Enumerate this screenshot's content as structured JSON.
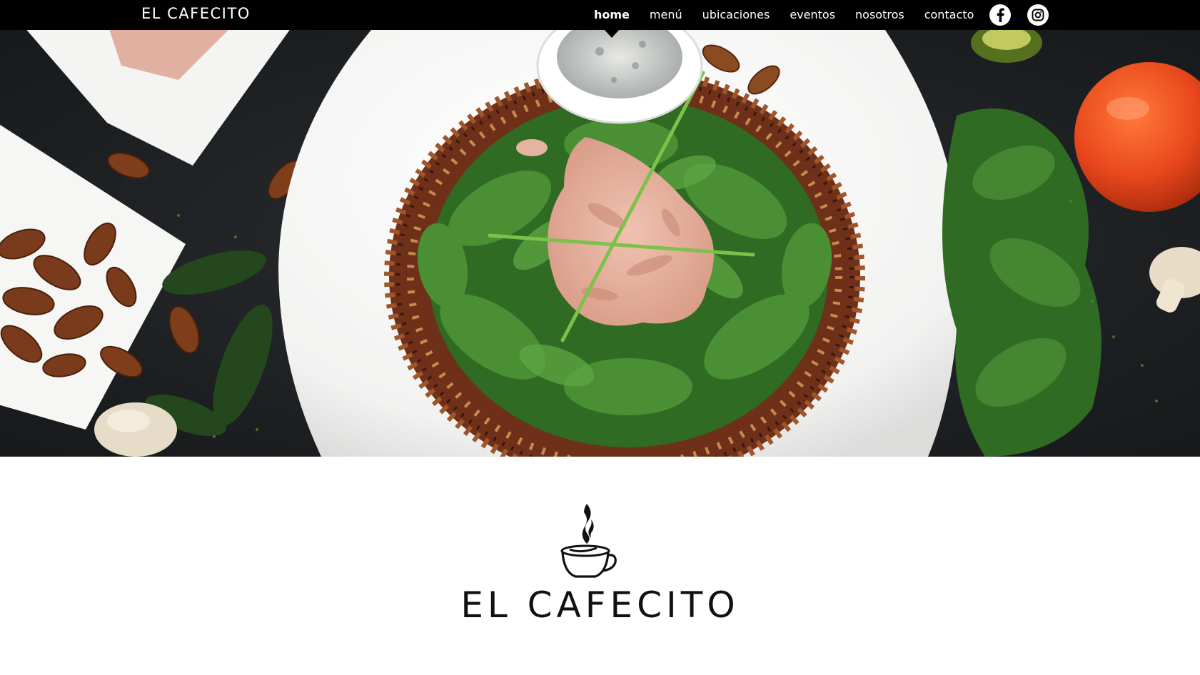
{
  "header": {
    "brand": "EL CAFECITO",
    "nav": [
      {
        "label": "home",
        "active": true
      },
      {
        "label": "menú",
        "active": false
      },
      {
        "label": "ubicaciones",
        "active": false
      },
      {
        "label": "eventos",
        "active": false
      },
      {
        "label": "nosotros",
        "active": false
      },
      {
        "label": "contacto",
        "active": false
      }
    ],
    "social": [
      {
        "name": "facebook-icon"
      },
      {
        "name": "instagram-icon"
      }
    ]
  },
  "hero": {
    "image": "salad-plate-photo",
    "colors": {
      "table": "#1f2225",
      "plate": "#f5f5f4",
      "spinach": "#3e7d2c",
      "tuna": "#e8b3a2",
      "pecan": "#7a3b1c",
      "tomato": "#e8471c"
    }
  },
  "logo": {
    "icon": "coffee-cup-icon",
    "text": "EL CAFECITO"
  },
  "colors": {
    "bar": "#000000",
    "nav_text": "#ffffff",
    "logo_text": "#111111"
  }
}
